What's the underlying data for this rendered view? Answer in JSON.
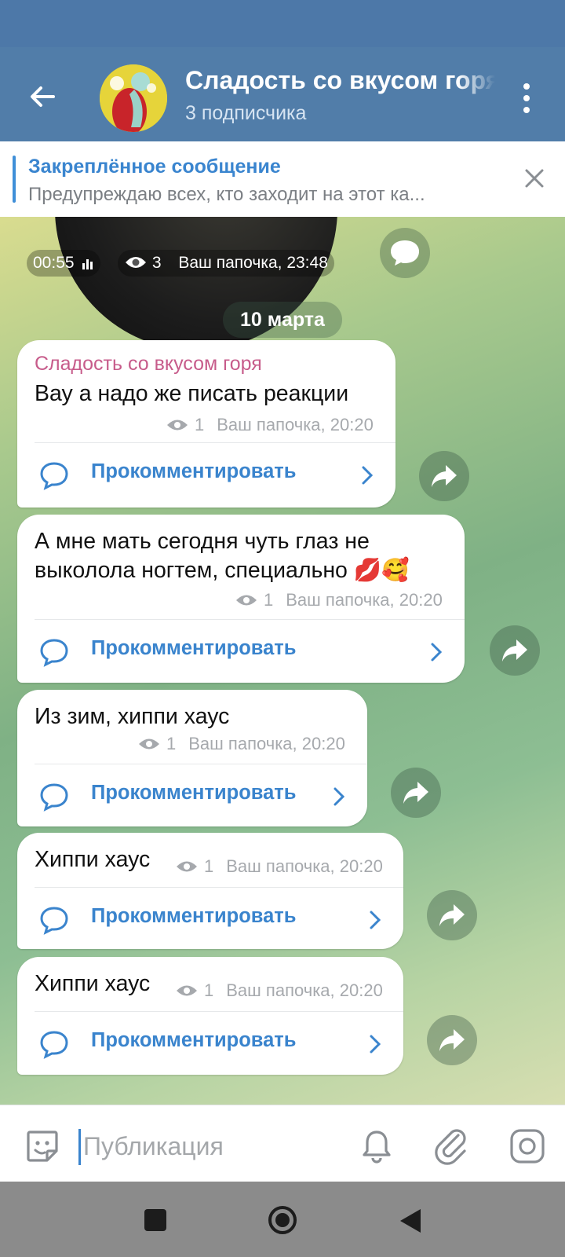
{
  "header": {
    "title": "Сладость со вкусом горя",
    "subscribers": "3 подписчика"
  },
  "pinned": {
    "title": "Закреплённое сообщение",
    "text": "Предупреждаю всех, кто заходит на этот ка..."
  },
  "video_message": {
    "duration": "00:55",
    "views": "3",
    "signature_time": "Ваш папочка, 23:48"
  },
  "date_separator": "10 марта",
  "messages": [
    {
      "author": "Сладость со вкусом горя",
      "text": "Вау а надо же писать реакции",
      "views": "1",
      "signature_time": "Ваш папочка, 20:20",
      "comment_label": "Прокомментировать"
    },
    {
      "text_line1": "А мне мать сегодня чуть глаз не",
      "text_line2": "выколола ногтем, специально",
      "emoji": "💋🥰",
      "views": "1",
      "signature_time": "Ваш папочка, 20:20",
      "comment_label": "Прокомментировать"
    },
    {
      "text": "Из зим, хиппи хаус",
      "views": "1",
      "signature_time": "Ваш папочка, 20:20",
      "comment_label": "Прокомментировать"
    },
    {
      "text": "Хиппи хаус",
      "views": "1",
      "signature_time": "Ваш папочка, 20:20",
      "comment_label": "Прокомментировать"
    },
    {
      "text": "Хиппи хаус",
      "views": "1",
      "signature_time": "Ваш папочка, 20:20",
      "comment_label": "Прокомментировать"
    }
  ],
  "input": {
    "placeholder": "Публикация"
  },
  "icons": [
    "back-arrow-icon",
    "more-vert-icon",
    "close-icon",
    "eye-icon",
    "comment-icon",
    "chevron-right-icon",
    "share-icon",
    "sticker-icon",
    "bell-icon",
    "paperclip-icon",
    "camera-icon"
  ],
  "colors": {
    "header": "#517da9",
    "accent": "#3a84cd",
    "author": "#c75c8b"
  }
}
